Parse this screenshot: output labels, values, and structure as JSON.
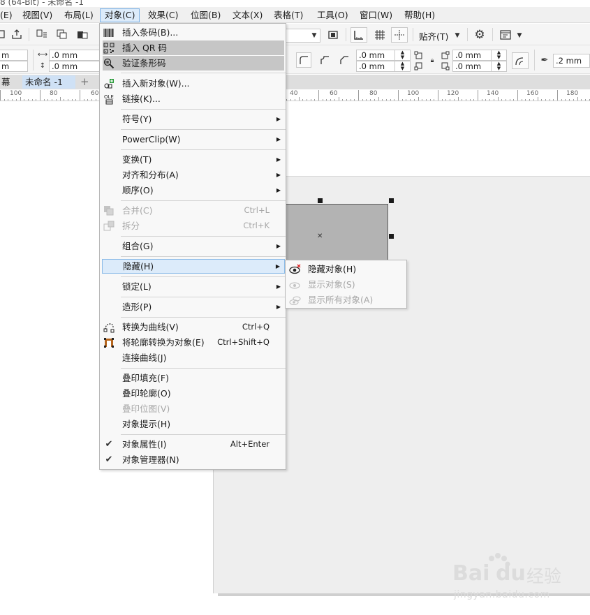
{
  "window": {
    "title": "8 (64-Bit) - 未命名 -1"
  },
  "menubar": {
    "items": [
      {
        "label": "(E)"
      },
      {
        "label": "视图(V)"
      },
      {
        "label": "布局(L)"
      },
      {
        "label": "对象(C)"
      },
      {
        "label": "效果(C)"
      },
      {
        "label": "位图(B)"
      },
      {
        "label": "文本(X)"
      },
      {
        "label": "表格(T)"
      },
      {
        "label": "工具(O)"
      },
      {
        "label": "窗口(W)"
      },
      {
        "label": "帮助(H)"
      }
    ]
  },
  "toolbar": {
    "snap_label": "贴齐(T)",
    "width_left": "m",
    "height_left": "m",
    "width_value": ".0 mm",
    "height_value": ".0 mm",
    "corner_value_1": ".0 mm",
    "corner_value_2": ".0 mm",
    "corner_value_3": ".0 mm",
    "corner_value_4": ".0 mm",
    "outline_width": ".2 mm"
  },
  "tabs": {
    "items": [
      {
        "label": "幕"
      },
      {
        "label": "未命名 -1"
      }
    ],
    "add_label": "+"
  },
  "ruler": {
    "labels": [
      "100",
      "80",
      "60",
      "40",
      "60",
      "80",
      "100",
      "120",
      "140",
      "160",
      "180"
    ]
  },
  "object_menu": {
    "items": [
      {
        "label": "插入条码(B)...",
        "shortcut": "",
        "icon": "barcode-icon"
      },
      {
        "label": "插入 QR 码",
        "shortcut": "",
        "icon": "qr-code-icon"
      },
      {
        "label": "验证条形码",
        "shortcut": "",
        "icon": "magnifier-icon"
      },
      {
        "label": "插入新对象(W)...",
        "shortcut": "",
        "icon": "insert-object-icon"
      },
      {
        "label": "链接(K)...",
        "shortcut": "",
        "icon": "ole-icon"
      },
      {
        "label": "符号(Y)",
        "shortcut": ""
      },
      {
        "label": "PowerClip(W)",
        "shortcut": ""
      },
      {
        "label": "变换(T)",
        "shortcut": ""
      },
      {
        "label": "对齐和分布(A)",
        "shortcut": ""
      },
      {
        "label": "顺序(O)",
        "shortcut": ""
      },
      {
        "label": "合并(C)",
        "shortcut": "Ctrl+L",
        "icon": "combine-icon"
      },
      {
        "label": "拆分",
        "shortcut": "Ctrl+K",
        "icon": "break-apart-icon"
      },
      {
        "label": "组合(G)",
        "shortcut": ""
      },
      {
        "label": "隐藏(H)",
        "shortcut": ""
      },
      {
        "label": "锁定(L)",
        "shortcut": ""
      },
      {
        "label": "造形(P)",
        "shortcut": ""
      },
      {
        "label": "转换为曲线(V)",
        "shortcut": "Ctrl+Q",
        "icon": "convert-curves-icon"
      },
      {
        "label": "将轮廓转换为对象(E)",
        "shortcut": "Ctrl+Shift+Q",
        "icon": "outline-to-object-icon"
      },
      {
        "label": "连接曲线(J)",
        "shortcut": ""
      },
      {
        "label": "叠印填充(F)",
        "shortcut": ""
      },
      {
        "label": "叠印轮廓(O)",
        "shortcut": ""
      },
      {
        "label": "叠印位图(V)",
        "shortcut": ""
      },
      {
        "label": "对象提示(H)",
        "shortcut": ""
      },
      {
        "label": "对象属性(I)",
        "shortcut": "Alt+Enter",
        "icon": "checkmark-icon"
      },
      {
        "label": "对象管理器(N)",
        "shortcut": "",
        "icon": "checkmark-icon"
      }
    ]
  },
  "hide_submenu": {
    "items": [
      {
        "label": "隐藏对象(H)",
        "icon": "hide-object-icon"
      },
      {
        "label": "显示对象(S)",
        "icon": "show-object-icon"
      },
      {
        "label": "显示所有对象(A)",
        "icon": "show-all-objects-icon"
      }
    ]
  },
  "watermark": {
    "brand": "Bai",
    "brand_du": "du",
    "product": "经验",
    "url": "jingyan.baidu.com"
  },
  "colors": {
    "highlight_blue": "#dcebfa",
    "highlight_border": "#8bbbe8",
    "selection_grey": "#c6c6c6",
    "object_fill": "#b3b3b3"
  }
}
